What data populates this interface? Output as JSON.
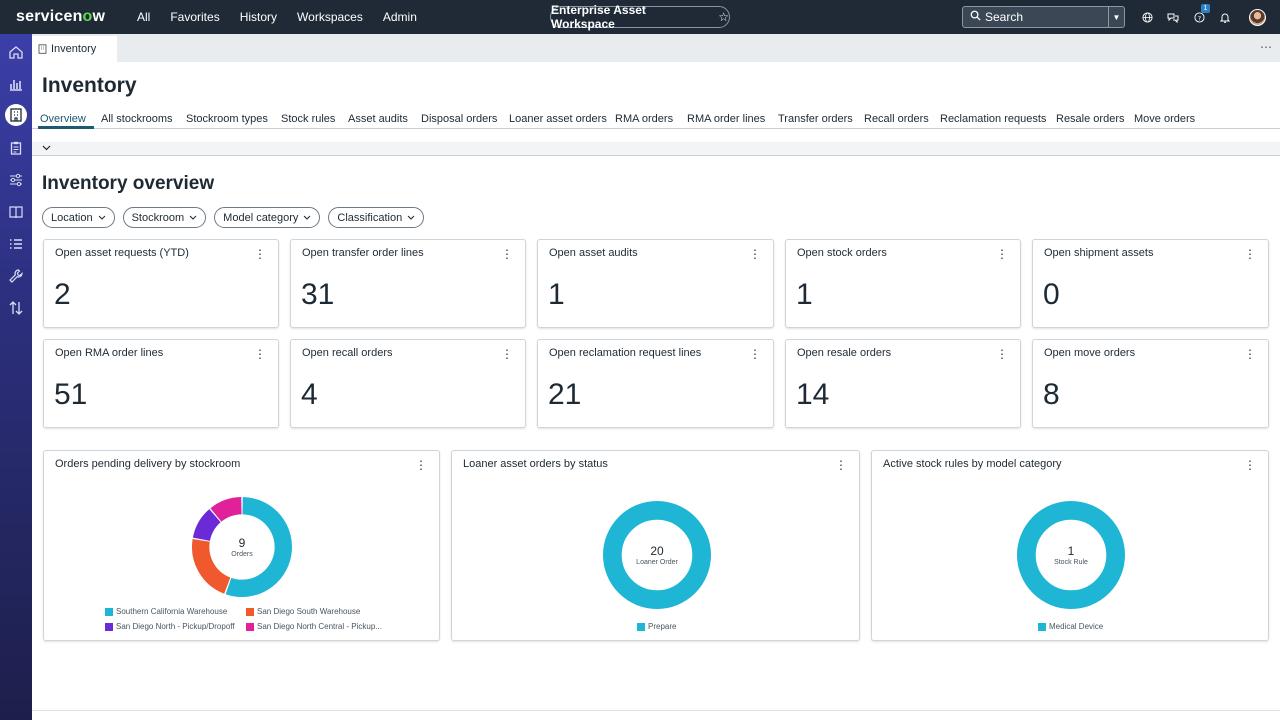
{
  "topbar": {
    "logo_prefix": "servicen",
    "logo_o": "o",
    "logo_suffix": "w",
    "nav": [
      "All",
      "Favorites",
      "History",
      "Workspaces",
      "Admin"
    ],
    "workspace_label": "Enterprise Asset Workspace",
    "search_label": "Search",
    "help_badge": "1"
  },
  "tab": {
    "label": "Inventory"
  },
  "page": {
    "title": "Inventory",
    "subtabs": [
      "Overview",
      "All stockrooms",
      "Stockroom types",
      "Stock rules",
      "Asset audits",
      "Disposal orders",
      "Loaner asset orders",
      "RMA orders",
      "RMA order lines",
      "Transfer orders",
      "Recall orders",
      "Reclamation requests",
      "Resale orders",
      "Move orders"
    ],
    "section_title": "Inventory overview",
    "filters": [
      "Location",
      "Stockroom",
      "Model category",
      "Classification"
    ]
  },
  "kpis": [
    {
      "title": "Open asset requests (YTD)",
      "value": "2"
    },
    {
      "title": "Open transfer order lines",
      "value": "31"
    },
    {
      "title": "Open asset audits",
      "value": "1"
    },
    {
      "title": "Open stock orders",
      "value": "1"
    },
    {
      "title": "Open shipment assets",
      "value": "0"
    },
    {
      "title": "Open RMA order lines",
      "value": "51"
    },
    {
      "title": "Open recall orders",
      "value": "4"
    },
    {
      "title": "Open reclamation request lines",
      "value": "21"
    },
    {
      "title": "Open resale orders",
      "value": "14"
    },
    {
      "title": "Open move orders",
      "value": "8"
    }
  ],
  "chart_data": [
    {
      "type": "pie",
      "title": "Orders pending delivery by stockroom",
      "center_value": "9",
      "center_label": "Orders",
      "categories": [
        "Southern California Warehouse",
        "San Diego South Warehouse",
        "San Diego North - Pickup/Dropoff",
        "San Diego North Central - Pickup..."
      ],
      "values": [
        5,
        2,
        1,
        1
      ],
      "colors": [
        "#1fb6d6",
        "#f0582e",
        "#6a2bd6",
        "#e0219a"
      ],
      "legend": "bottom"
    },
    {
      "type": "pie",
      "title": "Loaner asset orders by status",
      "center_value": "20",
      "center_label": "Loaner Order",
      "categories": [
        "Prepare"
      ],
      "values": [
        20
      ],
      "colors": [
        "#1fb6d6"
      ],
      "legend": "bottom"
    },
    {
      "type": "pie",
      "title": "Active stock rules by model category",
      "center_value": "1",
      "center_label": "Stock Rule",
      "categories": [
        "Medical Device"
      ],
      "values": [
        1
      ],
      "colors": [
        "#1fb6d6"
      ],
      "legend": "bottom"
    }
  ]
}
